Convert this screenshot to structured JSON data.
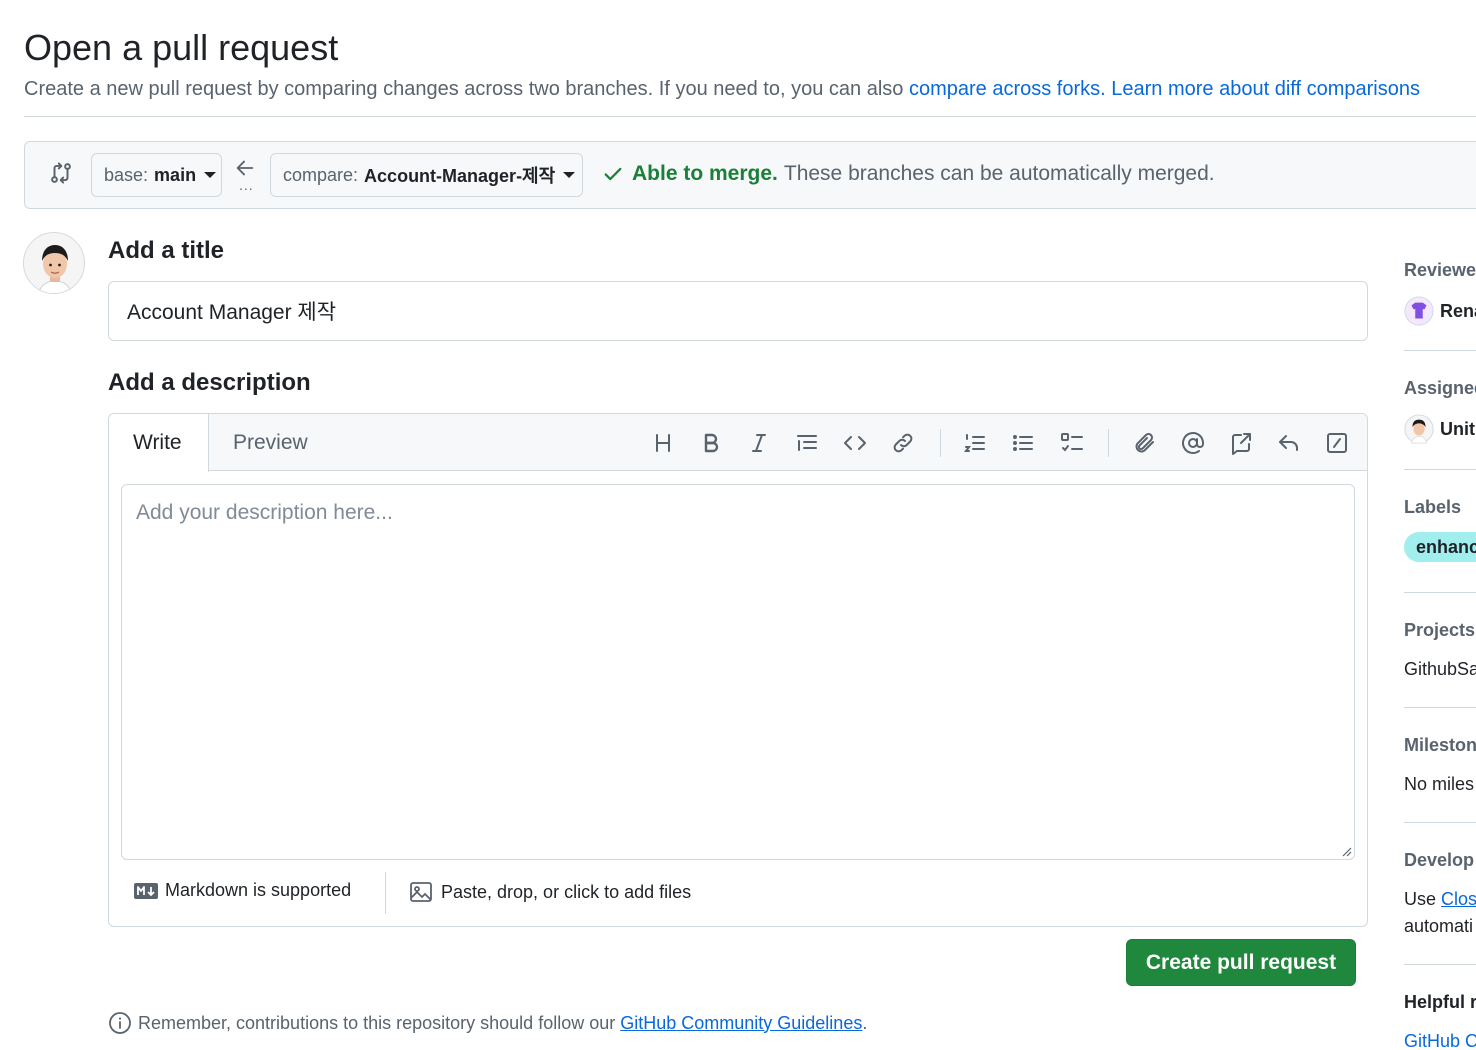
{
  "header": {
    "title": "Open a pull request",
    "subtitle": "Create a new pull request by comparing changes across two branches. If you need to, you can also",
    "compare_forks_link": "compare across forks.",
    "learn_more_link": "Learn more about diff comparisons"
  },
  "range": {
    "base_prefix": "base:",
    "base_branch": "main",
    "compare_prefix": "compare:",
    "compare_branch": "Account-Manager-제작",
    "dots": "...",
    "merge_status": "Able to merge.",
    "merge_message": "These branches can be automatically merged."
  },
  "form": {
    "title_label": "Add a title",
    "title_value": "Account Manager 제작",
    "description_label": "Add a description",
    "tabs": [
      "Write",
      "Preview"
    ],
    "description_placeholder": "Add your description here...",
    "markdown_note": "Markdown is supported",
    "attach_note": "Paste, drop, or click to add files",
    "submit_label": "Create pull request",
    "guidelines_prefix": "Remember, contributions to this repository should follow our",
    "guidelines_link": "GitHub Community Guidelines",
    "guidelines_suffix": "."
  },
  "toolbar": {
    "icons": [
      "heading-icon",
      "bold-icon",
      "italic-icon",
      "quote-icon",
      "code-icon",
      "link-icon",
      "ordered-list-icon",
      "unordered-list-icon",
      "task-list-icon",
      "attach-icon",
      "mention-icon",
      "reference-icon",
      "reply-icon",
      "slash-command-icon"
    ]
  },
  "sidebar": {
    "reviewers_heading": "Reviewer",
    "reviewer_name": "Rena",
    "assignees_heading": "Assignee",
    "assignee_name": "Unit",
    "labels_heading": "Labels",
    "label_name": "enhanc",
    "projects_heading": "Projects",
    "project_name": "GithubSa",
    "milestone_heading": "Mileston",
    "milestone_value": "No miles",
    "development_heading": "Develop",
    "development_use": "Use",
    "development_link": "Closi",
    "development_rest": "automati",
    "helpful_heading": "Helpful r",
    "helpful_link": "GitHub C"
  },
  "colors": {
    "accent": "#0969da",
    "success": "#1a7f37",
    "primary_button": "#1f883d",
    "label_bg": "#a2eeef"
  }
}
